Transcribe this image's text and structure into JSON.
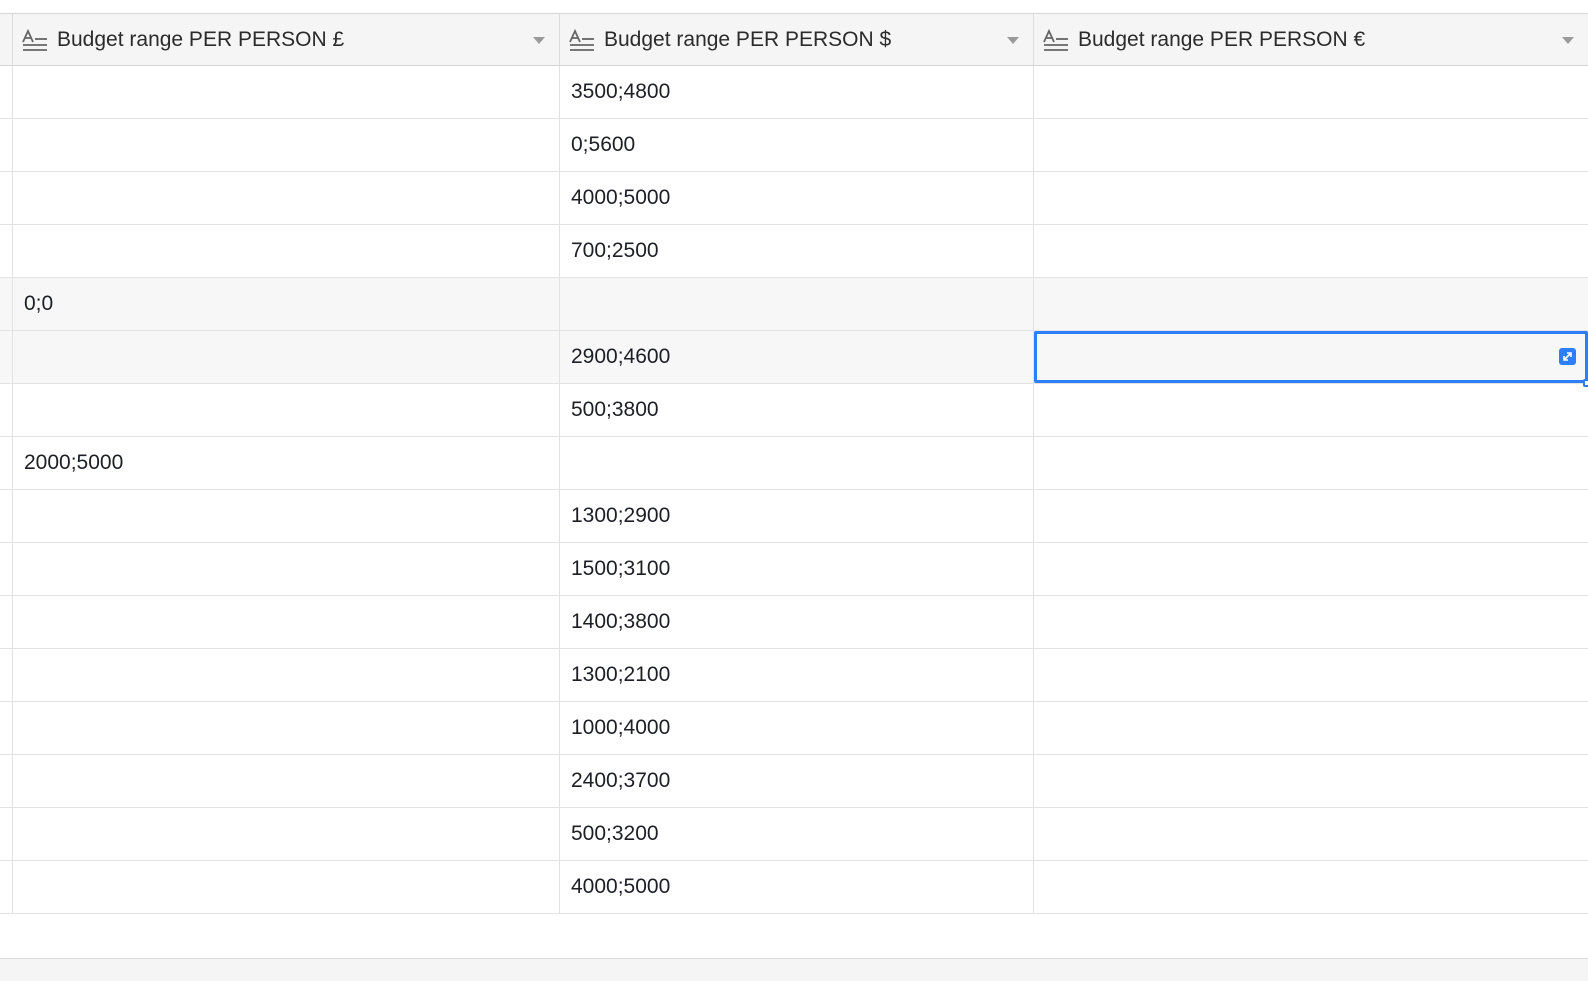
{
  "columns": [
    {
      "label": "Budget range PER PERSON £",
      "icon": "long-text-field-icon"
    },
    {
      "label": "Budget range PER PERSON $",
      "icon": "long-text-field-icon"
    },
    {
      "label": "Budget range PER PERSON €",
      "icon": "long-text-field-icon"
    }
  ],
  "rows": [
    [
      "",
      "3500;4800",
      ""
    ],
    [
      "",
      "0;5600",
      ""
    ],
    [
      "",
      "4000;5000",
      ""
    ],
    [
      "",
      "700;2500",
      ""
    ],
    [
      "0;0",
      "",
      ""
    ],
    [
      "",
      "2900;4600",
      ""
    ],
    [
      "",
      "500;3800",
      ""
    ],
    [
      "2000;5000",
      "",
      ""
    ],
    [
      "",
      "1300;2900",
      ""
    ],
    [
      "",
      "1500;3100",
      ""
    ],
    [
      "",
      "1400;3800",
      ""
    ],
    [
      "",
      "1300;2100",
      ""
    ],
    [
      "",
      "1000;4000",
      ""
    ],
    [
      "",
      "2400;3700",
      ""
    ],
    [
      "",
      "500;3200",
      ""
    ],
    [
      "",
      "4000;5000",
      ""
    ]
  ],
  "highlighted_rows": [
    4,
    5
  ],
  "selected_cell": {
    "row": 5,
    "col": 2
  },
  "colors": {
    "selection": "#2d7ff9",
    "header_bg": "#f5f5f5",
    "row_hover": "#f7f7f7"
  }
}
